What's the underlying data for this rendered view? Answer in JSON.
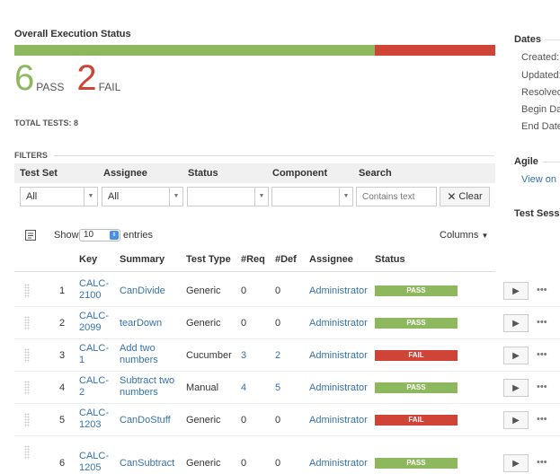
{
  "overall": {
    "title": "Overall Execution Status",
    "pass_count": "6",
    "pass_label": "PASS",
    "fail_count": "2",
    "fail_label": "FAIL",
    "pass_fraction": 0.75,
    "total_label": "TOTAL TESTS: 8",
    "colors": {
      "pass": "#8eb85e",
      "fail": "#d04437"
    }
  },
  "filters": {
    "label": "FILTERS",
    "headers": [
      "Test Set",
      "Assignee",
      "Status",
      "Component",
      "Search"
    ],
    "test_set_value": "All",
    "assignee_value": "All",
    "status_value": "",
    "component_value": "",
    "search_placeholder": "Contains text",
    "clear_label": "Clear"
  },
  "table_controls": {
    "show_label": "Show",
    "entries_value": "10",
    "entries_label": "entries",
    "columns_label": "Columns"
  },
  "table": {
    "headers": [
      "Key",
      "Summary",
      "Test Type",
      "#Req",
      "#Def",
      "Assignee",
      "Status"
    ],
    "rows": [
      {
        "index": "1",
        "key_line1": "CALC-",
        "key_line2": "2100",
        "summary_line1": "CanDivide",
        "summary_line2": "",
        "type": "Generic",
        "req": "0",
        "def": "0",
        "assignee": "Administrator",
        "status": "PASS"
      },
      {
        "index": "2",
        "key_line1": "CALC-",
        "key_line2": "2099",
        "summary_line1": "tearDown",
        "summary_line2": "",
        "type": "Generic",
        "req": "0",
        "def": "0",
        "assignee": "Administrator",
        "status": "PASS"
      },
      {
        "index": "3",
        "key_line1": "CALC-",
        "key_line2": "1",
        "summary_line1": "Add two",
        "summary_line2": "numbers",
        "type": "Cucumber",
        "req": "3",
        "def": "2",
        "assignee": "Administrator",
        "status": "FAIL"
      },
      {
        "index": "4",
        "key_line1": "CALC-",
        "key_line2": "2",
        "summary_line1": "Subtract two",
        "summary_line2": "numbers",
        "type": "Manual",
        "req": "4",
        "def": "5",
        "assignee": "Administrator",
        "status": "PASS"
      },
      {
        "index": "5",
        "key_line1": "CALC-",
        "key_line2": "1203",
        "summary_line1": "CanDoStuff",
        "summary_line2": "",
        "type": "Generic",
        "req": "0",
        "def": "0",
        "assignee": "Administrator",
        "status": "FAIL"
      },
      {
        "index": "6",
        "key_line1": "CALC-",
        "key_line2": "1205",
        "summary_line1": "CanSubtract",
        "summary_line2": "",
        "type": "Generic",
        "req": "0",
        "def": "0",
        "assignee": "Administrator",
        "status": "PASS"
      }
    ]
  },
  "sidebar": {
    "dates_title": "Dates",
    "dates": [
      "Created:",
      "Updated:",
      "Resolved",
      "Begin Da",
      "End Date"
    ],
    "agile_title": "Agile",
    "agile_link": "View on",
    "test_sessions_title": "Test Sess"
  }
}
